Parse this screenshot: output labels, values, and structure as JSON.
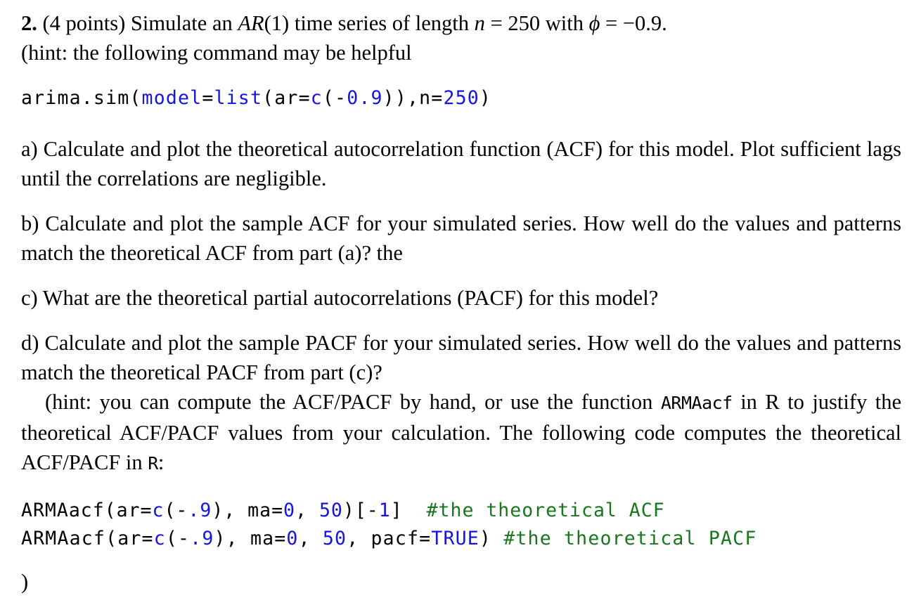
{
  "document": {
    "type": "homework-problem",
    "background_color": "#ffffff",
    "text_color": "#000000",
    "code_blue": "#1414e8",
    "code_green": "#17771d"
  },
  "problem": {
    "number": "2.",
    "points": "(4 points)",
    "statement_pre": "Simulate an ",
    "model_label": "AR",
    "model_order": "(1)",
    "statement_mid": " time series of length ",
    "n_symbol": "n",
    "n_eq": " = ",
    "n_value": "250",
    "statement_with": " with ",
    "phi_symbol": "ϕ",
    "phi_eq": " = ",
    "phi_value": "−0.9.",
    "hint_line": "(hint: the following command may be helpful"
  },
  "code_sim": {
    "tokens": [
      {
        "text": "arima.sim(",
        "color": "black"
      },
      {
        "text": "model",
        "color": "blue"
      },
      {
        "text": "=",
        "color": "black"
      },
      {
        "text": "list",
        "color": "blue"
      },
      {
        "text": "(ar=",
        "color": "black"
      },
      {
        "text": "c",
        "color": "blue"
      },
      {
        "text": "(-",
        "color": "black"
      },
      {
        "text": "0.9",
        "color": "blue"
      },
      {
        "text": ")),n=",
        "color": "black"
      },
      {
        "text": "250",
        "color": "blue"
      },
      {
        "text": ")",
        "color": "black"
      }
    ],
    "plain": "arima.sim(model=list(ar=c(-0.9)),n=250)",
    "seg1": "arima.sim(",
    "seg2": "model",
    "seg3": "=",
    "seg4": "list",
    "seg5": "(ar=",
    "seg6": "c",
    "seg7": "(-",
    "seg8": "0.9",
    "seg9": ")),n=",
    "seg10": "250",
    "seg11": ")"
  },
  "parts": {
    "a": "a) Calculate and plot the theoretical autocorrelation function (ACF) for this model. Plot sufficient lags until the correlations are negligible.",
    "b": "b) Calculate and plot the sample ACF for your simulated series. How well do the values and patterns match the theoretical ACF from part (a)? the",
    "c": "c) What are the theoretical partial autocorrelations (PACF) for this model?",
    "d": "d) Calculate and plot the sample PACF for your simulated series. How well do the values and patterns match the theoretical PACF from part (c)?"
  },
  "hint": {
    "seg1": "(hint: you can compute the ACF/PACF by hand, or use the function ",
    "fn_name": "ARMAacf",
    "seg2": " in R to justify the theoretical ACF/PACF values from your calculation. The following code computes the theoretical ACF/PACF in ",
    "r_name": "R",
    "seg3": ":"
  },
  "code_acf": {
    "plain": "ARMAacf(ar=c(-.9), ma=0, 50)[-1]  #the theoretical ACF",
    "seg1": "ARMAacf(ar=",
    "seg2": "c",
    "seg3": "(-",
    "seg4": ".9",
    "seg5": "), ma=",
    "seg6": "0",
    "seg7": ", ",
    "seg8": "50",
    "seg9": ")[-",
    "seg10": "1",
    "seg11": "]  ",
    "comment": "#the theoretical ACF"
  },
  "code_pacf": {
    "plain": "ARMAacf(ar=c(-.9), ma=0, 50, pacf=TRUE) #the theoretical PACF",
    "seg1": "ARMAacf(ar=",
    "seg2": "c",
    "seg3": "(-",
    "seg4": ".9",
    "seg5": "), ma=",
    "seg6": "0",
    "seg7": ", ",
    "seg8": "50",
    "seg9": ", pacf=",
    "seg10": "TRUE",
    "seg11": ") ",
    "comment": "#the theoretical PACF"
  },
  "tail": {
    "closing_paren": ")"
  }
}
